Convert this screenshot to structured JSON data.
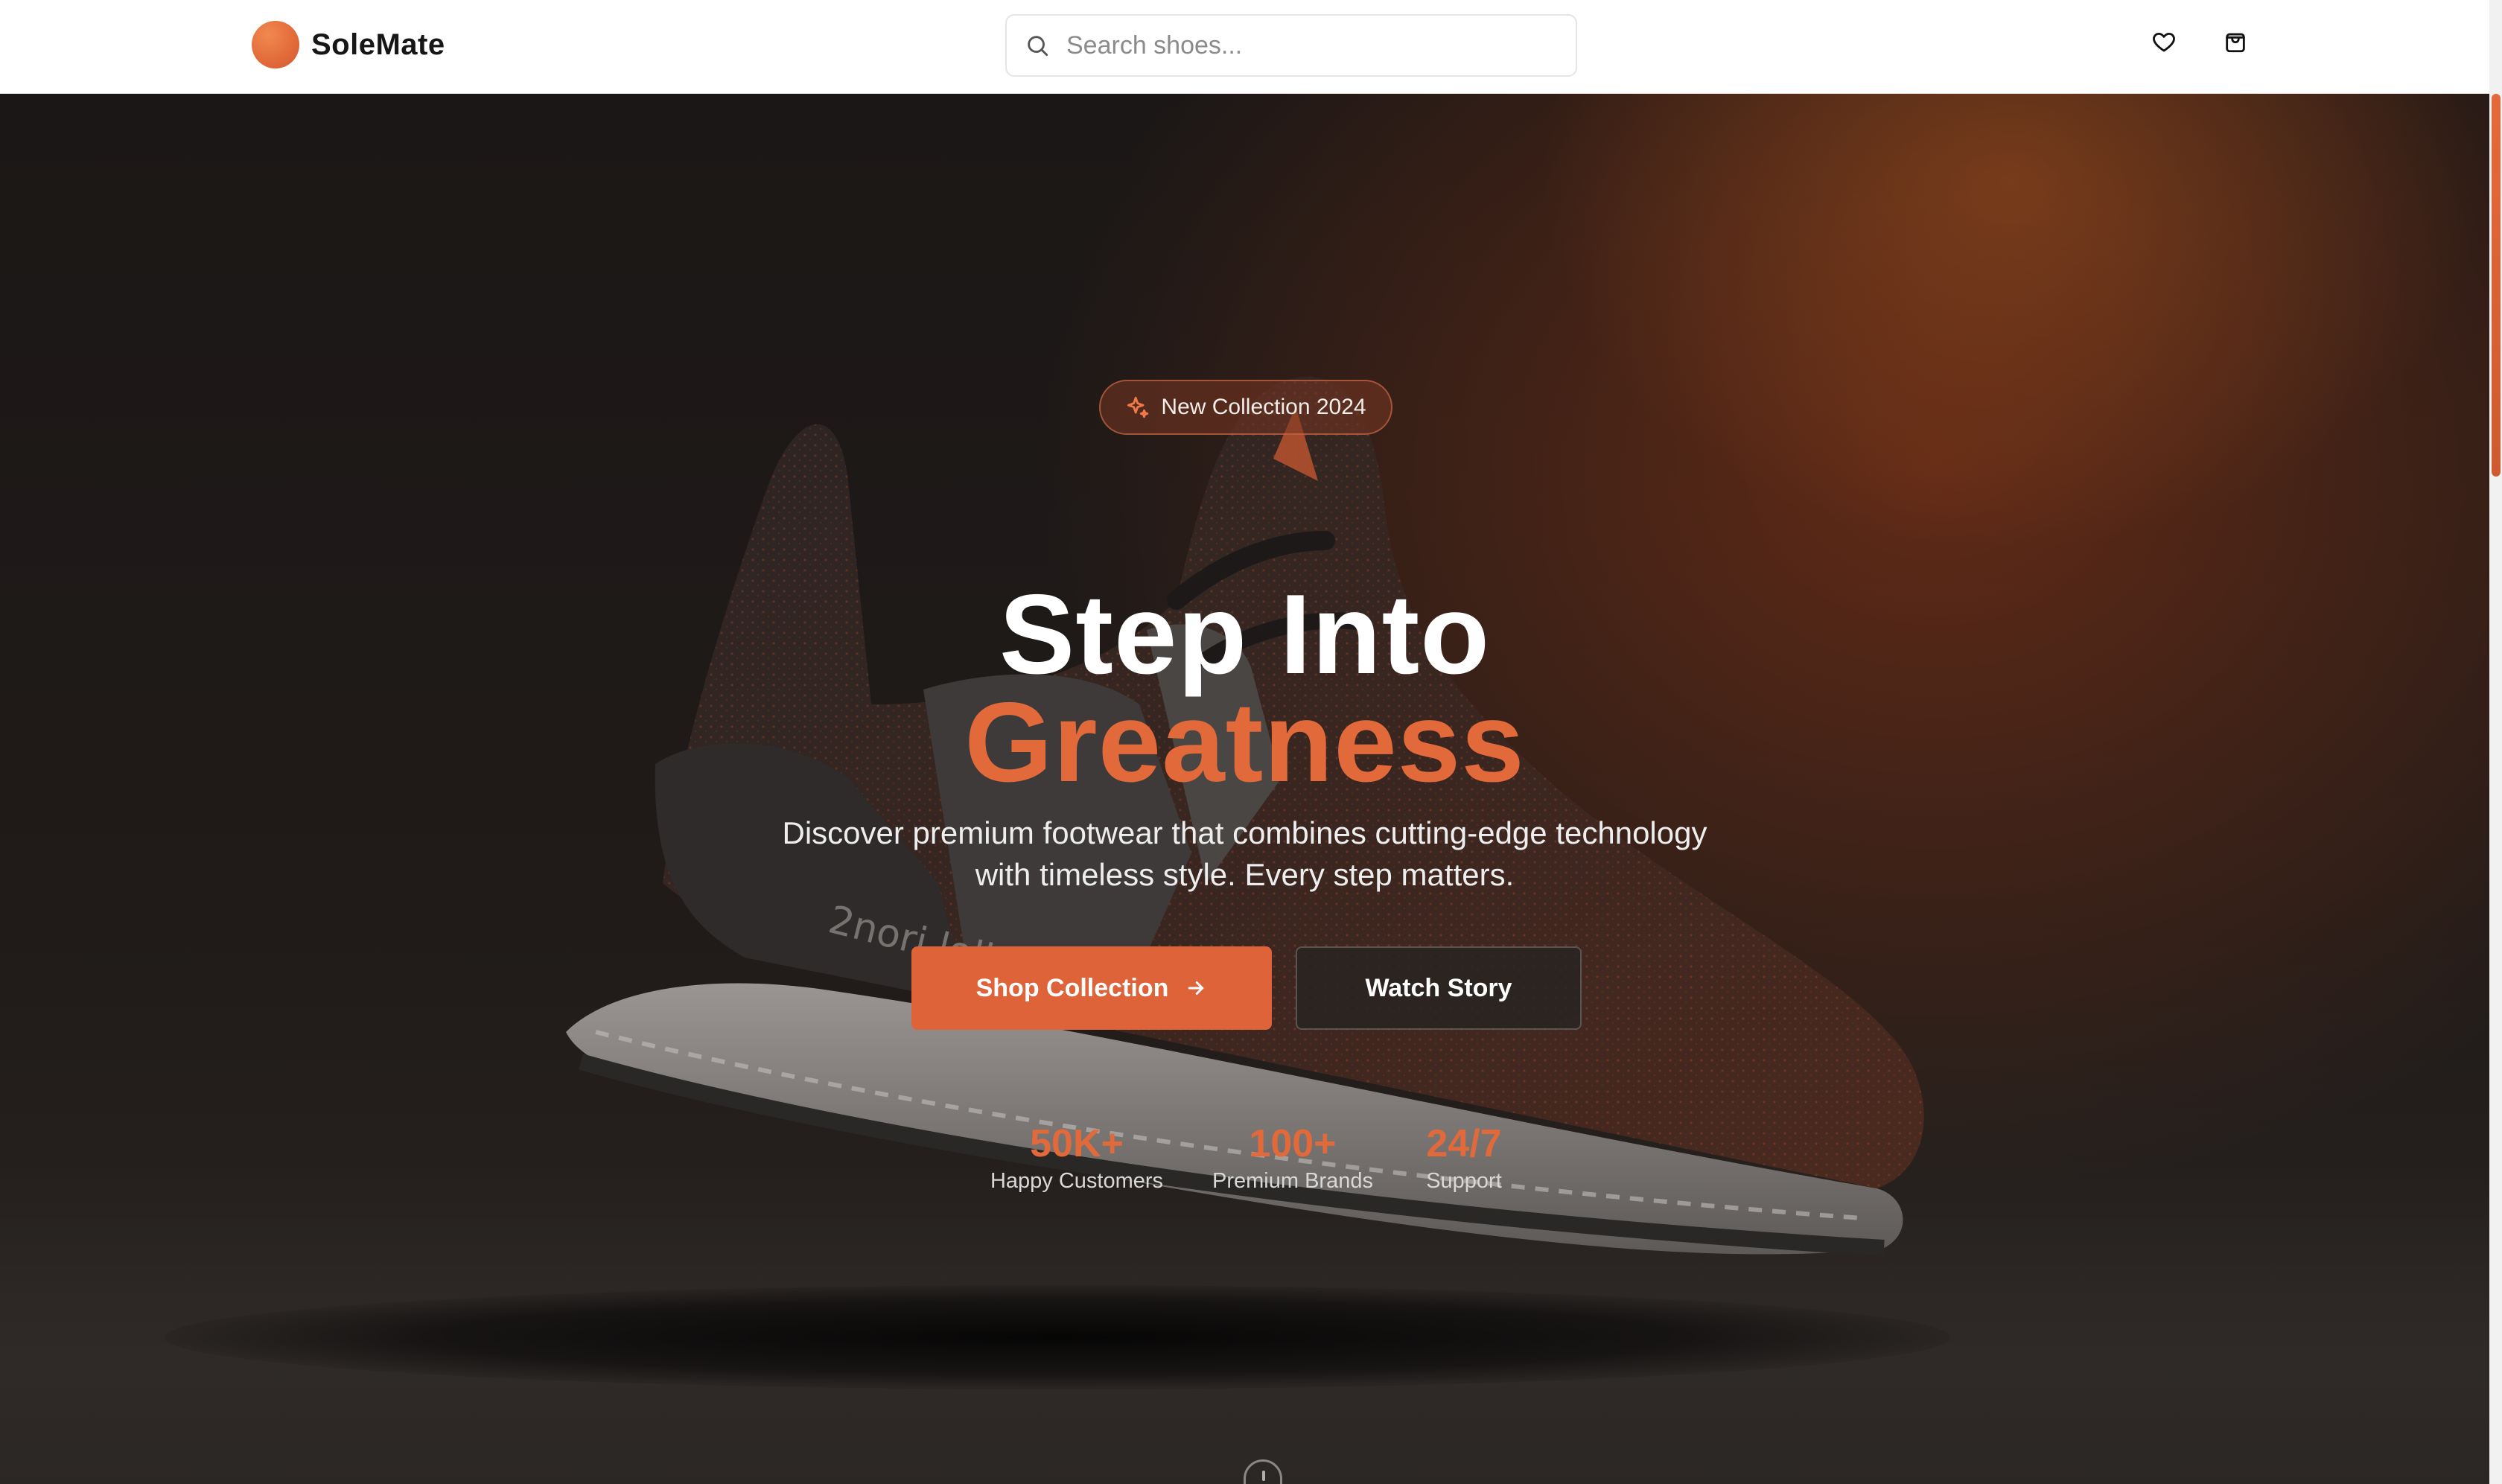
{
  "header": {
    "brand_name": "SoleMate",
    "search_placeholder": "Search shoes...",
    "icons": [
      "search-icon",
      "heart-icon",
      "shopping-bag-icon"
    ]
  },
  "hero": {
    "badge": "New Collection 2024",
    "title_line1": "Step Into",
    "title_line2": "Greatness",
    "subtitle_line1": "Discover premium footwear that combines cutting-edge technology",
    "subtitle_line2": "with timeless style. Every step matters.",
    "primary_button": "Shop Collection",
    "secondary_button": "Watch Story",
    "stats": [
      {
        "value": "50K+",
        "label": "Happy Customers"
      },
      {
        "value": "100+",
        "label": "Premium Brands"
      },
      {
        "value": "24/7",
        "label": "Support"
      }
    ],
    "shoe_print": "2nori lolle"
  },
  "colors": {
    "accent": "#E2693A",
    "button_primary": "#DE6339",
    "header_bg": "#FFFFFF",
    "hero_bg": "#1D1A19"
  }
}
